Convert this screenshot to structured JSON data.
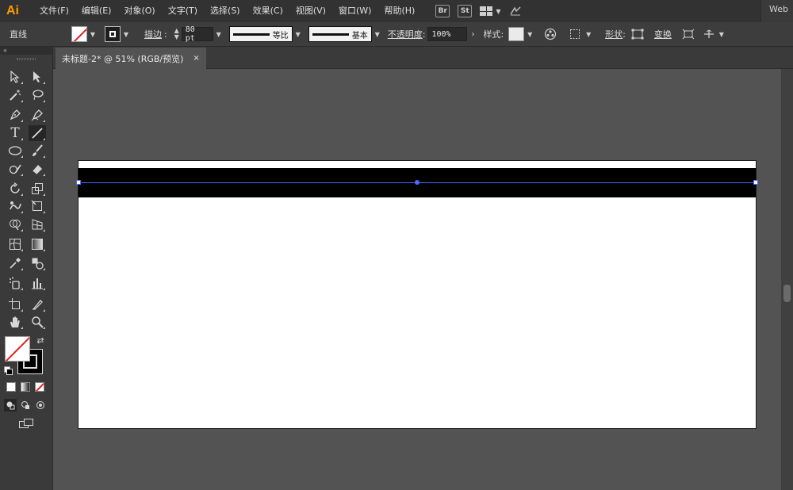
{
  "app": {
    "logo": "Ai",
    "workspace": "Web"
  },
  "menu": [
    "文件(F)",
    "编辑(E)",
    "对象(O)",
    "文字(T)",
    "选择(S)",
    "效果(C)",
    "视图(V)",
    "窗口(W)",
    "帮助(H)"
  ],
  "menubar_icons": {
    "bridge": "Br",
    "stock": "St"
  },
  "control": {
    "tool_name": "直线",
    "stroke_label": "描边",
    "stroke_weight": "80 pt",
    "profile_label": "等比",
    "brush_label": "基本",
    "opacity_label": "不透明度",
    "opacity_value": "100%",
    "style_label": "样式",
    "shape_label": "形状",
    "transform_label": "变换"
  },
  "document": {
    "tab_title": "未标题-2* @ 51% (RGB/预览)",
    "close_glyph": "×"
  },
  "toolbar": {
    "collapse_glyph": "«"
  },
  "colors": {
    "accent": "#ff9a00",
    "selection": "#4a6bff",
    "none_slash": "#e0201e"
  }
}
